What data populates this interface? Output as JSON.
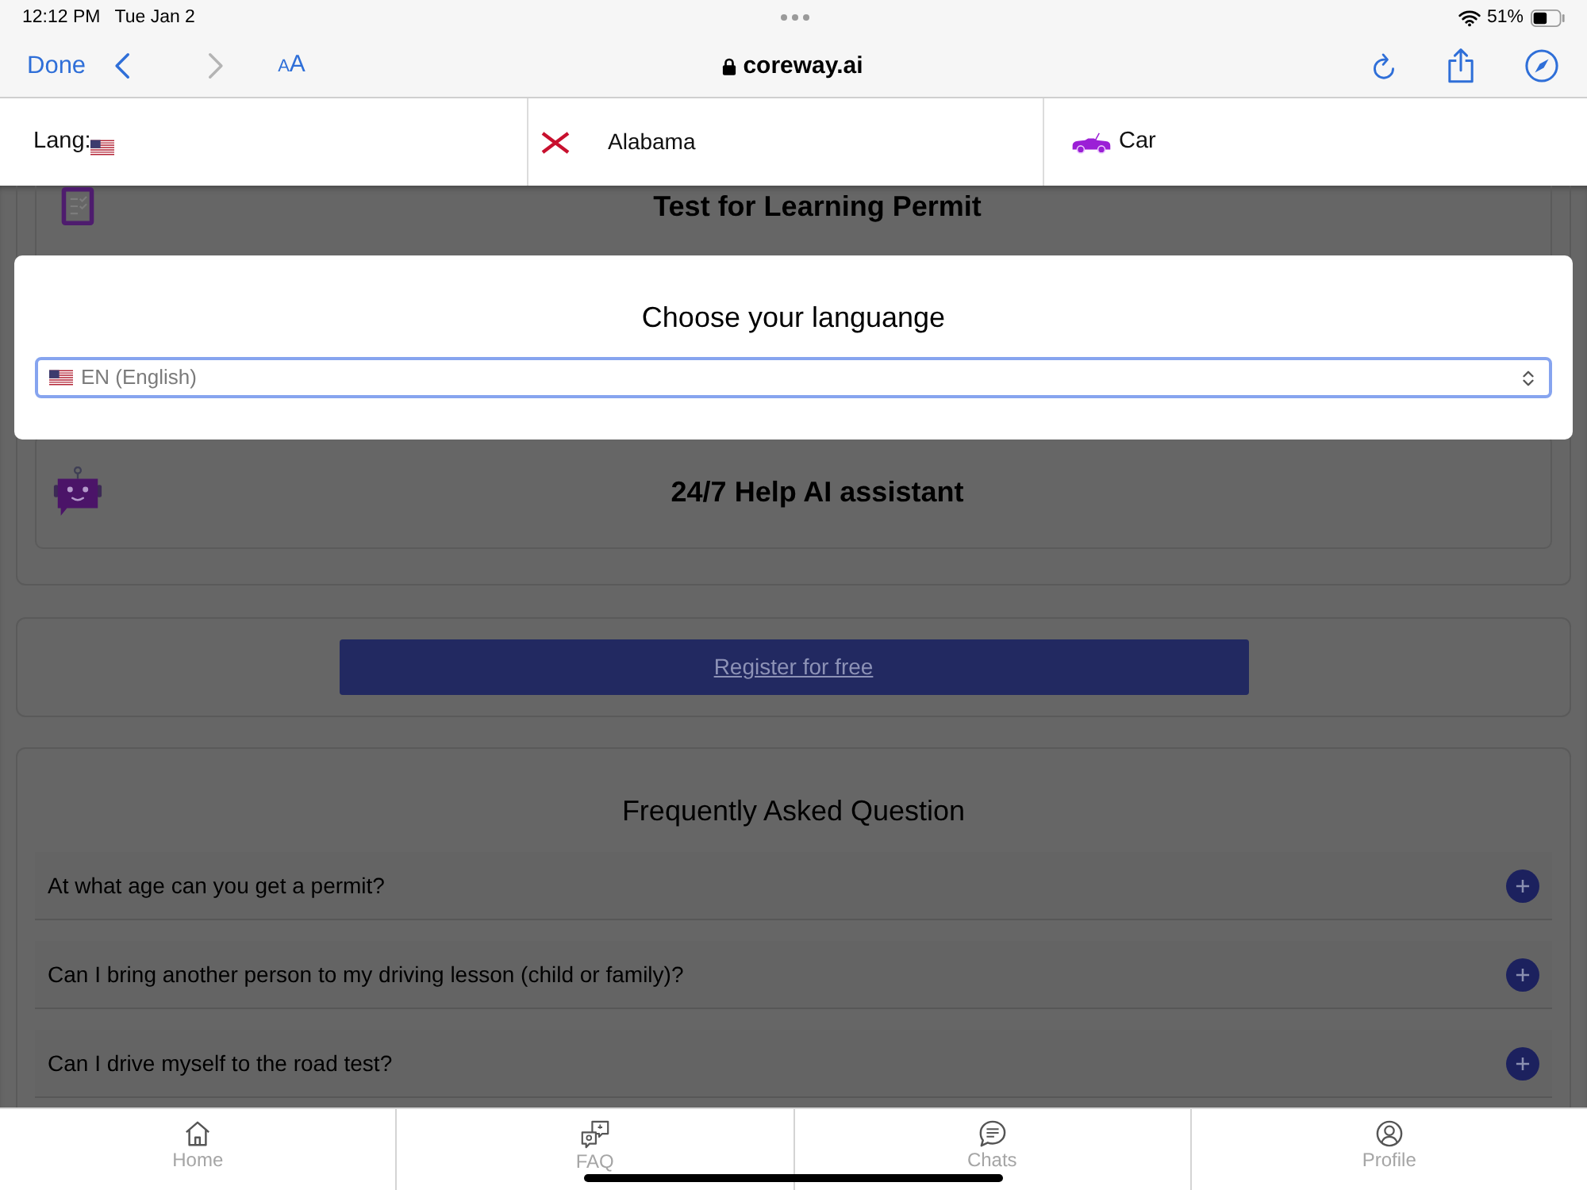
{
  "status_bar": {
    "time": "12:12 PM",
    "date": "Tue Jan 2",
    "battery": "51%"
  },
  "browser": {
    "done": "Done",
    "back": {
      "disabled": false
    },
    "forward": {
      "disabled": true
    },
    "text_size": "AA",
    "url": "coreway.ai"
  },
  "header": {
    "language_label": "Lang:",
    "state": "Alabama",
    "vehicle": "Car"
  },
  "features": [
    {
      "title": "Test for Learning Permit"
    },
    {
      "title": "24/7 Help AI assistant"
    }
  ],
  "register_button": "Register for free",
  "faq": {
    "title": "Frequently Asked Question",
    "items": [
      {
        "question": "At what age can you get a permit?",
        "expanded": false
      },
      {
        "question": "Can I bring another person to my driving lesson (child or family)?",
        "expanded": false
      },
      {
        "question": "Can I drive myself to the road test?",
        "expanded": false
      }
    ]
  },
  "language_dialog": {
    "title": "Choose your languange",
    "value": "EN (English)"
  },
  "tab_bar": [
    {
      "label": "Home",
      "selected": false
    },
    {
      "label": "FAQ",
      "selected": false
    },
    {
      "label": "Chats",
      "selected": false
    },
    {
      "label": "Profile",
      "selected": false
    }
  ]
}
